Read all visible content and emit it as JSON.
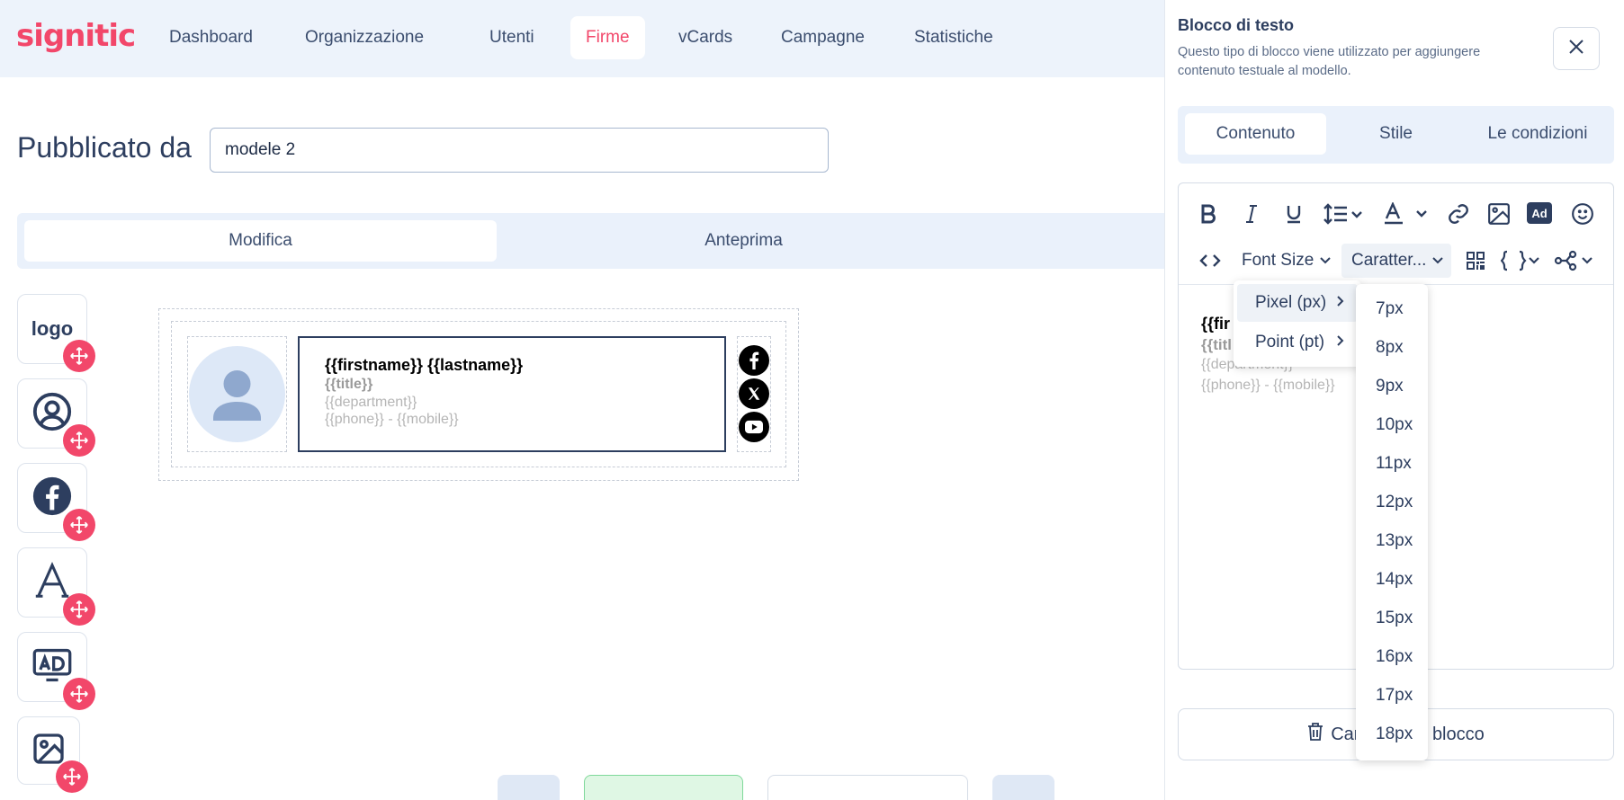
{
  "app": {
    "logo": "signitic"
  },
  "nav": {
    "items": [
      {
        "label": "Dashboard"
      },
      {
        "label": "Organizzazione"
      },
      {
        "label": "Utenti"
      },
      {
        "label": "Firme",
        "active": true
      },
      {
        "label": "vCards"
      },
      {
        "label": "Campagne"
      },
      {
        "label": "Statistiche"
      }
    ]
  },
  "header": {
    "title": "Pubblicato da",
    "name_value": "modele 2"
  },
  "mode_tabs": [
    {
      "label": "Modifica",
      "active": true
    },
    {
      "label": "Anteprima"
    }
  ],
  "tools": [
    {
      "label": "logo",
      "icon": "logo-text"
    },
    {
      "icon": "user-circle-icon"
    },
    {
      "icon": "facebook-icon"
    },
    {
      "icon": "text-a-icon"
    },
    {
      "icon": "ad-icon"
    },
    {
      "icon": "image-icon"
    }
  ],
  "signature": {
    "name": "{{firstname}} {{lastname}}",
    "title": "{{title}}",
    "department": "{{department}}",
    "phone": "{{phone}} - {{mobile}}",
    "socials": [
      "facebook",
      "x",
      "youtube"
    ]
  },
  "panel": {
    "title": "Blocco di testo",
    "description": "Questo tipo di blocco viene utilizzato per aggiungere contenuto testuale al modello.",
    "tabs": [
      {
        "label": "Contenuto",
        "active": true
      },
      {
        "label": "Stile"
      },
      {
        "label": "Le condizioni"
      }
    ],
    "toolbar": {
      "font_size_label": "Font Size",
      "font_family_label": "Caratter...",
      "ad_badge": "Ad"
    },
    "editor_text": {
      "line1": "{{fir",
      "line2": "{{titl",
      "line3": "{{department}}",
      "line4": "{{phone}} - {{mobile}}"
    },
    "delete_label": "Cancella blocco",
    "delete_visible_left": "Can",
    "delete_visible_right": "blocco"
  },
  "unit_menu": [
    {
      "label": "Pixel (px)",
      "active": true
    },
    {
      "label": "Point (pt)"
    }
  ],
  "size_menu": [
    "7px",
    "8px",
    "9px",
    "10px",
    "11px",
    "12px",
    "13px",
    "14px",
    "15px",
    "16px",
    "17px",
    "18px"
  ],
  "colors": {
    "brand": "#f2476a",
    "navy": "#2d3e5f",
    "nav_bg": "#edf3fb"
  }
}
